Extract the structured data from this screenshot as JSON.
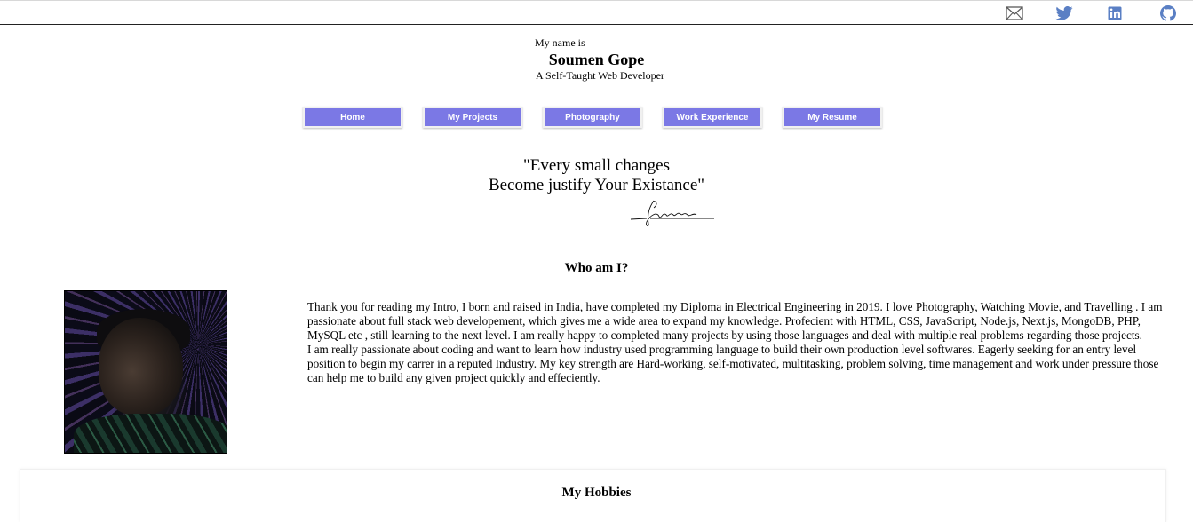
{
  "header": {
    "social_links": [
      {
        "name": "mail-icon",
        "color": "#5a5a5a"
      },
      {
        "name": "twitter-icon",
        "color": "#5a7fc4"
      },
      {
        "name": "linkedin-icon",
        "color": "#5a7fc4"
      },
      {
        "name": "github-icon",
        "color": "#5a7fc4"
      }
    ]
  },
  "intro": {
    "greeting": "My name is",
    "name": "Soumen Gope",
    "tagline": "A Self-Taught Web Developer"
  },
  "nav": {
    "accent": "#7b78e5",
    "items": [
      "Home",
      "My Projects",
      "Photography",
      "Work Experience",
      "My Resume"
    ]
  },
  "quote": {
    "line1": "\"Every small changes",
    "line2": "Become justify Your Existance\""
  },
  "about": {
    "title": "Who am I?",
    "paragraph1": "Thank you for reading my Intro, I born and raised in India, have completed my Diploma in Electrical Engineering in 2019. I love Photography, Watching Movie, and Travelling . I am passionate about full stack web developement, which gives me a wide area to expand my knowledge. Profecient with HTML, CSS, JavaScript, Node.js, Next.js, MongoDB, PHP, MySQL etc , still learning to the next level. I am really happy to completed many projects by using those languages and deal with multiple real problems regarding those projects.",
    "paragraph2": "I am really passionate about coding and want to learn how industry used programming language to build their own production level softwares. Eagerly seeking for an entry level position to begin my carrer in a reputed Industry. My key strength are Hard-working, self-motivated, multitasking, problem solving, time management and work under pressure those can help me to build any given project quickly and effeciently."
  },
  "hobbies": {
    "title": "My Hobbies"
  }
}
